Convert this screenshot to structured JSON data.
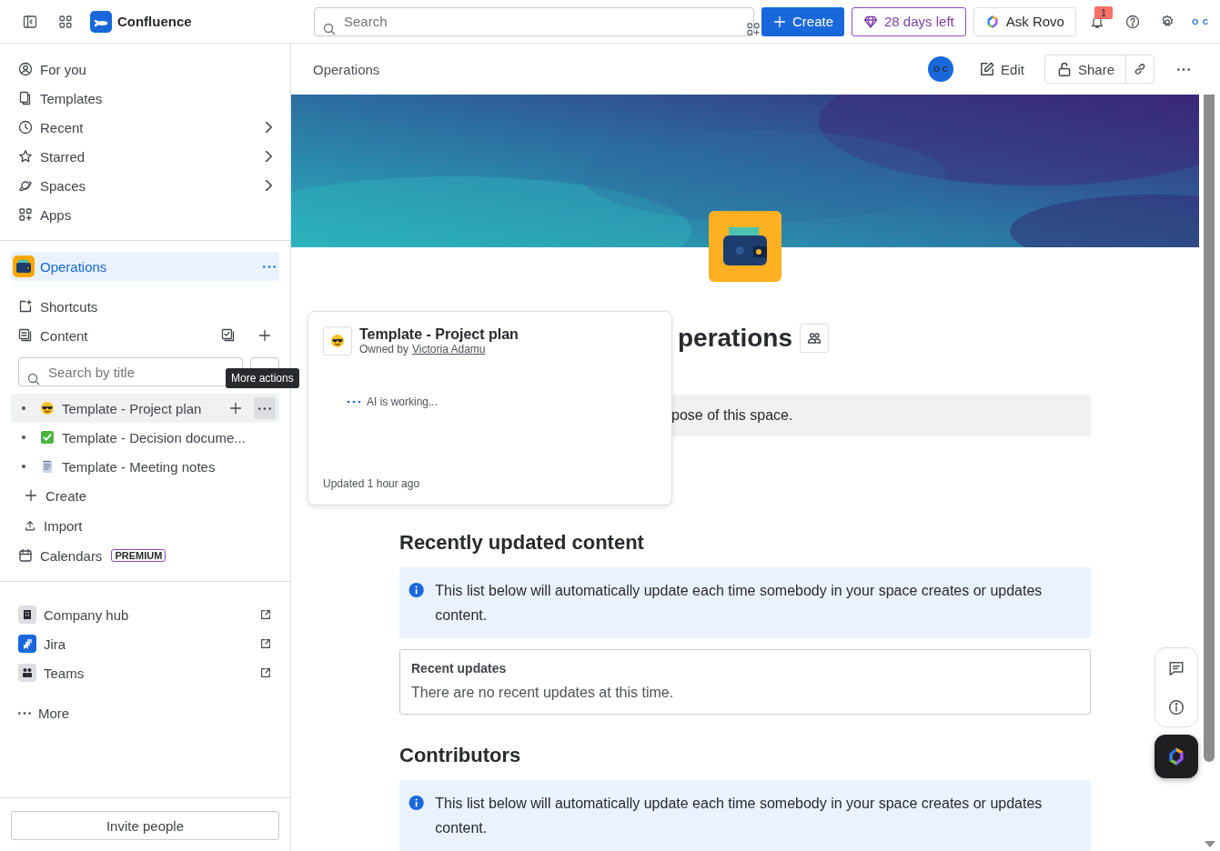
{
  "topbar": {
    "product": "Confluence",
    "search": {
      "placeholder": "Search"
    },
    "create": "Create",
    "trial": "28 days left",
    "ask": "Ask Rovo",
    "notification_count": "1",
    "avatar_text": "O C"
  },
  "sidebar": {
    "nav": [
      {
        "label": "For you",
        "chevron": false,
        "selected": false
      },
      {
        "label": "Templates",
        "chevron": false,
        "selected": false
      },
      {
        "label": "Recent",
        "chevron": true,
        "selected": false
      },
      {
        "label": "Starred",
        "chevron": true,
        "selected": false
      },
      {
        "label": "Spaces",
        "chevron": true,
        "selected": false
      },
      {
        "label": "Apps",
        "chevron": false,
        "selected": false
      }
    ],
    "space": {
      "name": "Operations",
      "selected": true
    },
    "sections": [
      {
        "label": "Shortcuts"
      },
      {
        "label": "Content"
      }
    ],
    "content_search": {
      "placeholder": "Search by title"
    },
    "tree": [
      {
        "label": "Template - Project plan",
        "selected": true
      },
      {
        "label": "Template - Decision docume...",
        "selected": false
      },
      {
        "label": "Template - Meeting notes",
        "selected": false
      }
    ],
    "create": "Create",
    "import": "Import",
    "calendars": {
      "label": "Calendars",
      "badge": "PREMIUM"
    },
    "apps": [
      {
        "label": "Company hub",
        "kind": "hub"
      },
      {
        "label": "Jira",
        "kind": "jira"
      },
      {
        "label": "Teams",
        "kind": "teams"
      }
    ],
    "more": "More",
    "invite": "Invite people"
  },
  "tooltip": "More actions",
  "header": {
    "breadcrumb": "Operations",
    "avatar_text": "O C",
    "edit": "Edit",
    "share": "Share"
  },
  "page": {
    "title": "perations",
    "purpose": "pose of this space.",
    "sections": [
      {
        "heading": "Recently updated content",
        "info": "This list below will automatically update each time somebody in your space creates or updates content.",
        "panel": {
          "title": "Recent updates",
          "text": "There are no recent updates at this time."
        }
      },
      {
        "heading": "Contributors",
        "info": "This list below will automatically update each time somebody in your space creates or updates content."
      }
    ]
  },
  "hover_card": {
    "title": "Template - Project plan",
    "owner_prefix": "Owned by",
    "owner": "Victoria Adamu",
    "status": "AI is working...",
    "updated": "Updated 1 hour ago"
  }
}
